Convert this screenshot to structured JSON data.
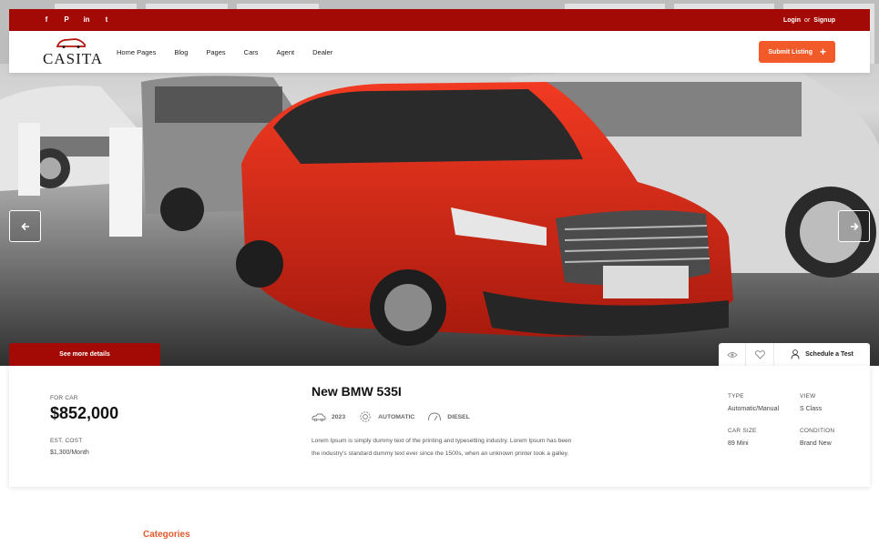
{
  "topbar": {
    "socials": [
      {
        "icon": "facebook-icon",
        "glyph": "f"
      },
      {
        "icon": "pinterest-icon",
        "glyph": "P"
      },
      {
        "icon": "linkedin-icon",
        "glyph": "in"
      },
      {
        "icon": "twitter-icon",
        "glyph": "t"
      }
    ],
    "login": "Login",
    "or": "or",
    "signup": "Signup"
  },
  "brand": {
    "name": "CASITA"
  },
  "nav": {
    "items": [
      "Home Pages",
      "Blog",
      "Pages",
      "Cars",
      "Agent",
      "Dealer"
    ],
    "submit_label": "Submit Listing",
    "submit_icon": "+"
  },
  "slider": {
    "prev_icon": "arrow-left-icon",
    "next_icon": "arrow-right-icon"
  },
  "listing": {
    "see_more": "See more details",
    "schedule": "Schedule a Test",
    "for_label": "FOR CAR",
    "price": "$852,000",
    "est_label": "EST. COST",
    "est_value": "$1,300/Month",
    "title": "New BMW 535I",
    "specs": [
      {
        "icon": "car-icon",
        "text": "2023"
      },
      {
        "icon": "gear-icon",
        "text": "AUTOMATIC"
      },
      {
        "icon": "fuel-icon",
        "text": "DIESEL"
      }
    ],
    "description": "Lorem Ipsum is simply dummy text of the printing and typesetting industry. Lorem Ipsum has been the industry's standard dummy text ever since the 1500s, when an unknown printer took a galley.",
    "meta": [
      {
        "label": "TYPE",
        "value": "Automatic/Manual"
      },
      {
        "label": "VIEW",
        "value": "S Class"
      },
      {
        "label": "CAR SIZE",
        "value": "89 Mini"
      },
      {
        "label": "CONDITION",
        "value": "Brand New"
      }
    ]
  },
  "categories_heading": "Categories",
  "colors": {
    "brand_red": "#a30a05",
    "accent_orange": "#f35a2a"
  }
}
